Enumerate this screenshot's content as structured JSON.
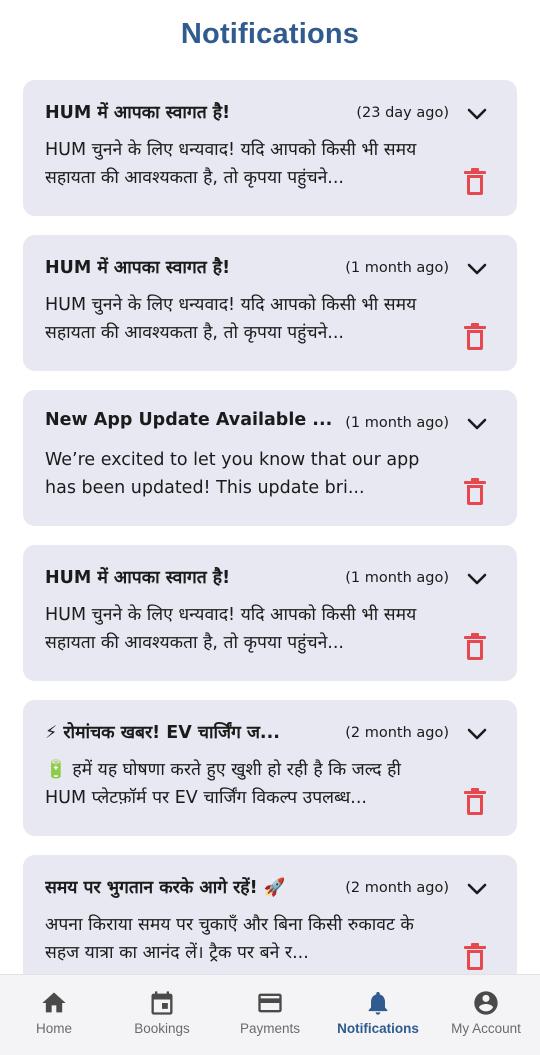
{
  "page": {
    "title": "Notifications"
  },
  "notifications": [
    {
      "title": "HUM में आपका स्वागत है!",
      "time": "(23 day ago)",
      "body": "HUM चुनने के लिए धन्यवाद! यदि आपको किसी भी समय सहायता की आवश्यकता है, तो कृपया पहुंचने..."
    },
    {
      "title": "HUM में आपका स्वागत है!",
      "time": "(1 month ago)",
      "body": "HUM चुनने के लिए धन्यवाद! यदि आपको किसी भी समय सहायता की आवश्यकता है, तो कृपया पहुंचने..."
    },
    {
      "title": "New App Update Available ...",
      "time": "(1 month ago)",
      "body": "We’re excited to let you know that our app has been updated! This update bri..."
    },
    {
      "title": "HUM में आपका स्वागत है!",
      "time": "(1 month ago)",
      "body": "HUM चुनने के लिए धन्यवाद! यदि आपको किसी भी समय सहायता की आवश्यकता है, तो कृपया पहुंचने..."
    },
    {
      "title": "⚡ रोमांचक खबर! EV चार्जिंग ज...",
      "time": "(2 month ago)",
      "body": "🔋 हमें यह घोषणा करते हुए खुशी हो रही है कि जल्द ही HUM प्लेटफ़ॉर्म पर EV चार्जिंग विकल्प उपलब्ध..."
    },
    {
      "title": "समय पर भुगतान करके आगे रहें! 🚀",
      "time": "(2 month ago)",
      "body": "अपना किराया समय पर चुकाएँ और बिना किसी रुकावट के सहज यात्रा का आनंद लें। ट्रैक पर बने र..."
    }
  ],
  "nav": {
    "items": [
      {
        "label": "Home",
        "icon": "home-icon",
        "active": false
      },
      {
        "label": "Bookings",
        "icon": "calendar-icon",
        "active": false
      },
      {
        "label": "Payments",
        "icon": "credit-card-icon",
        "active": false
      },
      {
        "label": "Notifications",
        "icon": "bell-icon",
        "active": true
      },
      {
        "label": "My Account",
        "icon": "account-circle-icon",
        "active": false
      }
    ]
  },
  "colors": {
    "accent": "#2f5b8f",
    "card_bg": "#e7e8f1",
    "trash": "#e5484d",
    "nav_inactive": "#6b6b6b"
  }
}
